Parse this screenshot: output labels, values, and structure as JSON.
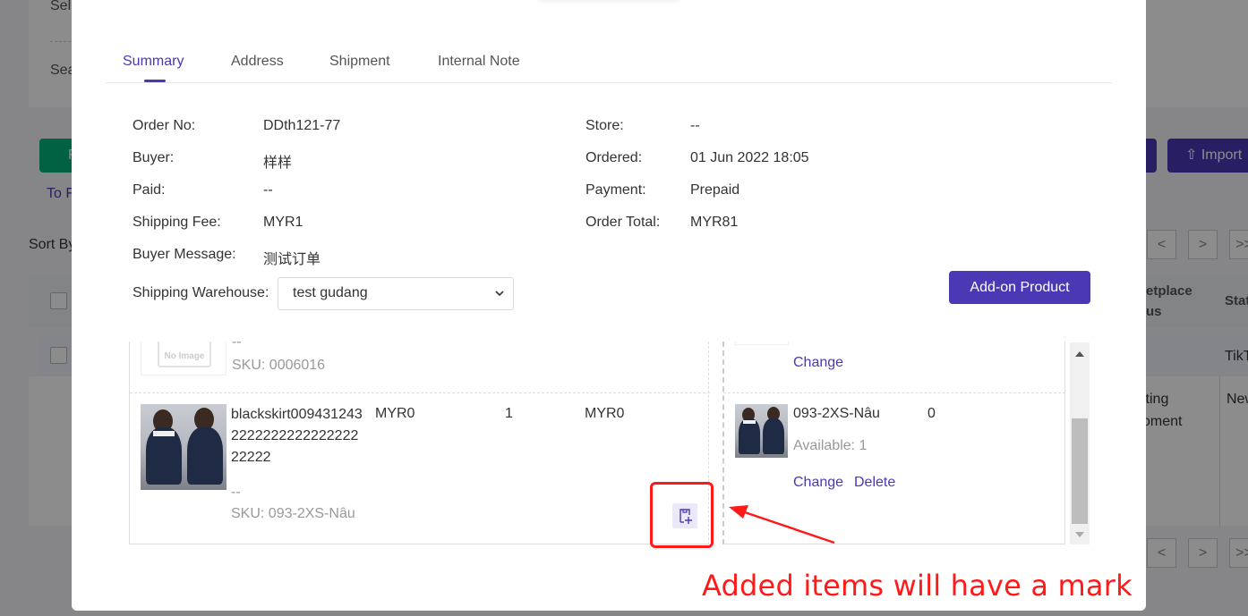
{
  "background": {
    "select_partial": "Sel",
    "search_partial": "Sea",
    "green_button_partial": "F",
    "import_button": "Import",
    "import_icon": "upload-icon",
    "to_link_partial": "To F",
    "sort_by_partial": "Sort By",
    "marketplace_col_partial_1": "etplace",
    "marketplace_col_partial_2": "us",
    "status_col_partial": "Stat",
    "platform_partial": "TikT",
    "waiting_partial_1": "iting",
    "waiting_partial_2": "oment",
    "new_partial": "New",
    "pager_prev": "<",
    "pager_next": ">",
    "pager_last": ">>"
  },
  "modal": {
    "tabs": [
      {
        "label": "Summary",
        "active": true
      },
      {
        "label": "Address",
        "active": false
      },
      {
        "label": "Shipment",
        "active": false
      },
      {
        "label": "Internal Note",
        "active": false
      }
    ],
    "info_left": [
      {
        "label": "Order No:",
        "value": "DDth121-77"
      },
      {
        "label": "Buyer:",
        "value": "样样"
      },
      {
        "label": "Paid:",
        "value": "--"
      },
      {
        "label": "Shipping Fee:",
        "value": "MYR1"
      },
      {
        "label": "Buyer Message:",
        "value": "测试订单"
      }
    ],
    "info_right": [
      {
        "label": "Store:",
        "value": "--"
      },
      {
        "label": "Ordered:",
        "value": "01 Jun 2022 18:05"
      },
      {
        "label": "Payment:",
        "value": "Prepaid"
      },
      {
        "label": "Order Total:",
        "value": "MYR81"
      }
    ],
    "shipping_warehouse": {
      "label": "Shipping Warehouse:",
      "value": "test gudang"
    },
    "add_on_button": "Add-on Product",
    "items": [
      {
        "image": "No Image",
        "variant": "--",
        "sku": "SKU: 0006016",
        "right": {
          "change": "Change"
        }
      },
      {
        "name": "blackskirt009431243222222222222222222222",
        "price": "MYR0",
        "qty": "1",
        "subtotal": "MYR0",
        "variant": "--",
        "sku": "SKU: 093-2XS-Nâu",
        "add_on_mark_icon": "add-on-mark-icon",
        "right": {
          "sku": "093-2XS-Nâu",
          "qty": "0",
          "available": "Available: 1",
          "change": "Change",
          "delete": "Delete"
        }
      }
    ]
  },
  "annotation": {
    "text": "Added items will have a mark",
    "color": "#ff1a1a"
  },
  "colors": {
    "primary": "#4a38b5",
    "green": "#00b27a",
    "mark_bg": "#ebe8fa"
  }
}
